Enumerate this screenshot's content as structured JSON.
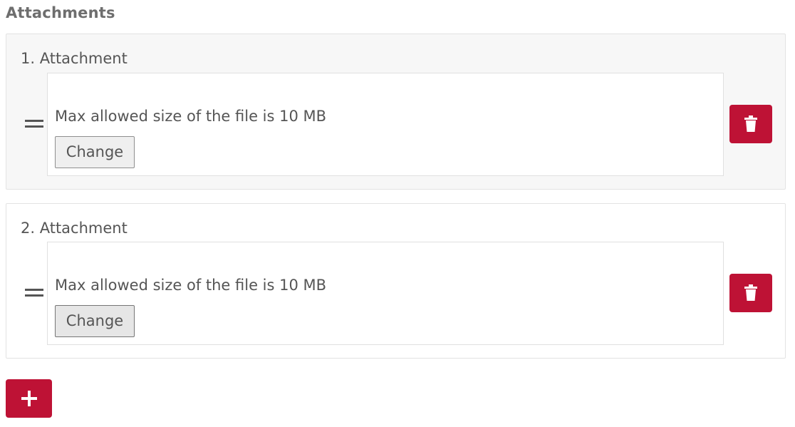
{
  "section": {
    "title": "Attachments"
  },
  "attachments": [
    {
      "label": "1. Attachment",
      "hint": "Max allowed size of the file is 10 MB",
      "change_label": "Change"
    },
    {
      "label": "2. Attachment",
      "hint": "Max allowed size of the file is 10 MB",
      "change_label": "Change"
    }
  ],
  "icons": {
    "drag": "drag-handle-icon",
    "delete": "trash-icon",
    "add": "plus-icon"
  },
  "colors": {
    "accent": "#be1235",
    "text": "#555555",
    "title": "#6e6e6e",
    "panel_bg_first": "#f7f7f7",
    "panel_border": "#e3e3e3"
  }
}
